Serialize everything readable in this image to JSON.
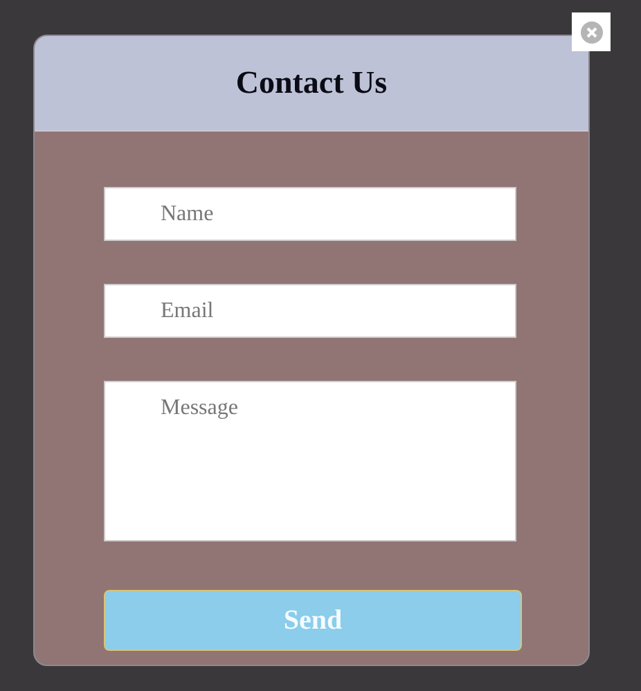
{
  "dialog": {
    "title": "Contact Us",
    "fields": [
      {
        "kind": "line",
        "placeholder": "Name"
      },
      {
        "kind": "line",
        "placeholder": "Email"
      },
      {
        "kind": "area",
        "placeholder": "Message"
      }
    ],
    "submit": "Send"
  }
}
